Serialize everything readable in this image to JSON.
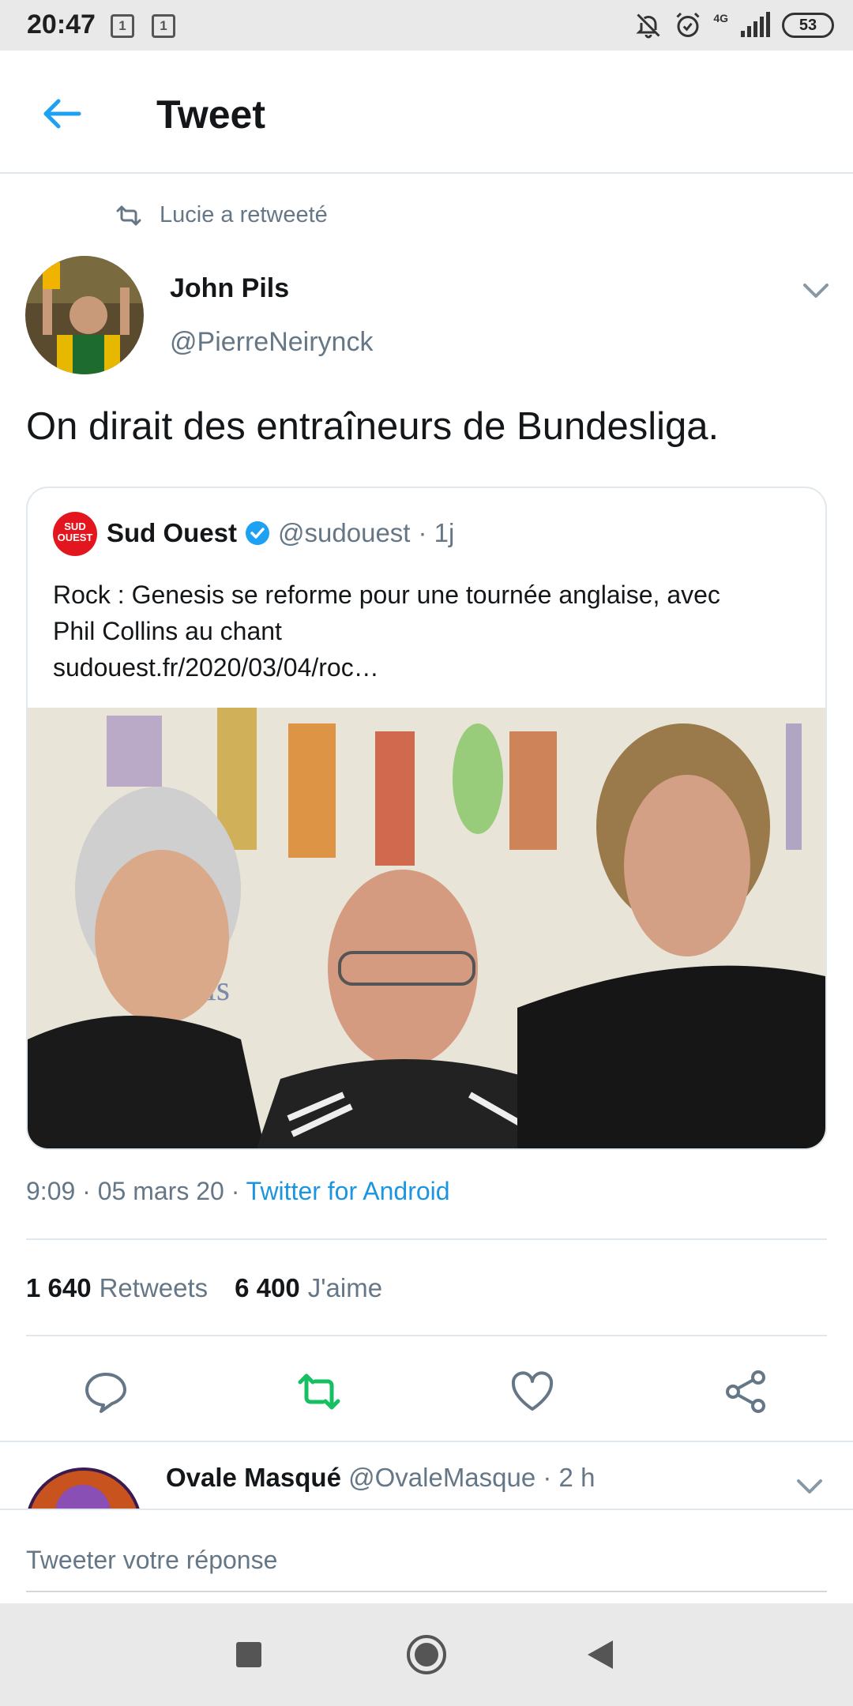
{
  "status_bar": {
    "time": "20:47",
    "sim1": "1",
    "sim2": "1",
    "network": "4G",
    "battery": "53"
  },
  "header": {
    "title": "Tweet"
  },
  "tweet": {
    "retweet_context": "Lucie a retweeté",
    "author_name": "John Pils",
    "author_handle": "@PierreNeirynck",
    "text": "On dirait des entraîneurs de Bundesliga.",
    "quoted": {
      "logo_text": "SUD OUEST",
      "name": "Sud Ouest",
      "handle": "@sudouest",
      "time": "· 1j",
      "body_line1": "Rock : Genesis se reforme pour une tournée anglaise, avec",
      "body_line2": "Phil Collins au chant",
      "link": "sudouest.fr/2020/03/04/roc…",
      "image_caption_fragment": "esis"
    },
    "meta": {
      "time_date": "9:09 · 05 mars 20 · ",
      "source": "Twitter for Android"
    },
    "stats": {
      "retweets_count": "1 640",
      "retweets_label": "Retweets",
      "likes_count": "6 400",
      "likes_label": "J'aime"
    }
  },
  "actions": {
    "reply_icon": "reply-icon",
    "retweet_icon": "retweet-icon",
    "like_icon": "heart-icon",
    "share_icon": "share-icon",
    "retweet_color": "#17bf63"
  },
  "next_reply": {
    "name": "Ovale Masqué",
    "handle": "@OvaleMasque",
    "time": "· 2 h"
  },
  "compose": {
    "placeholder": "Tweeter votre réponse"
  },
  "colors": {
    "accent": "#1da1f2",
    "link": "#1b95e0",
    "secondary_text": "#657786",
    "brand_red": "#e3161f"
  }
}
